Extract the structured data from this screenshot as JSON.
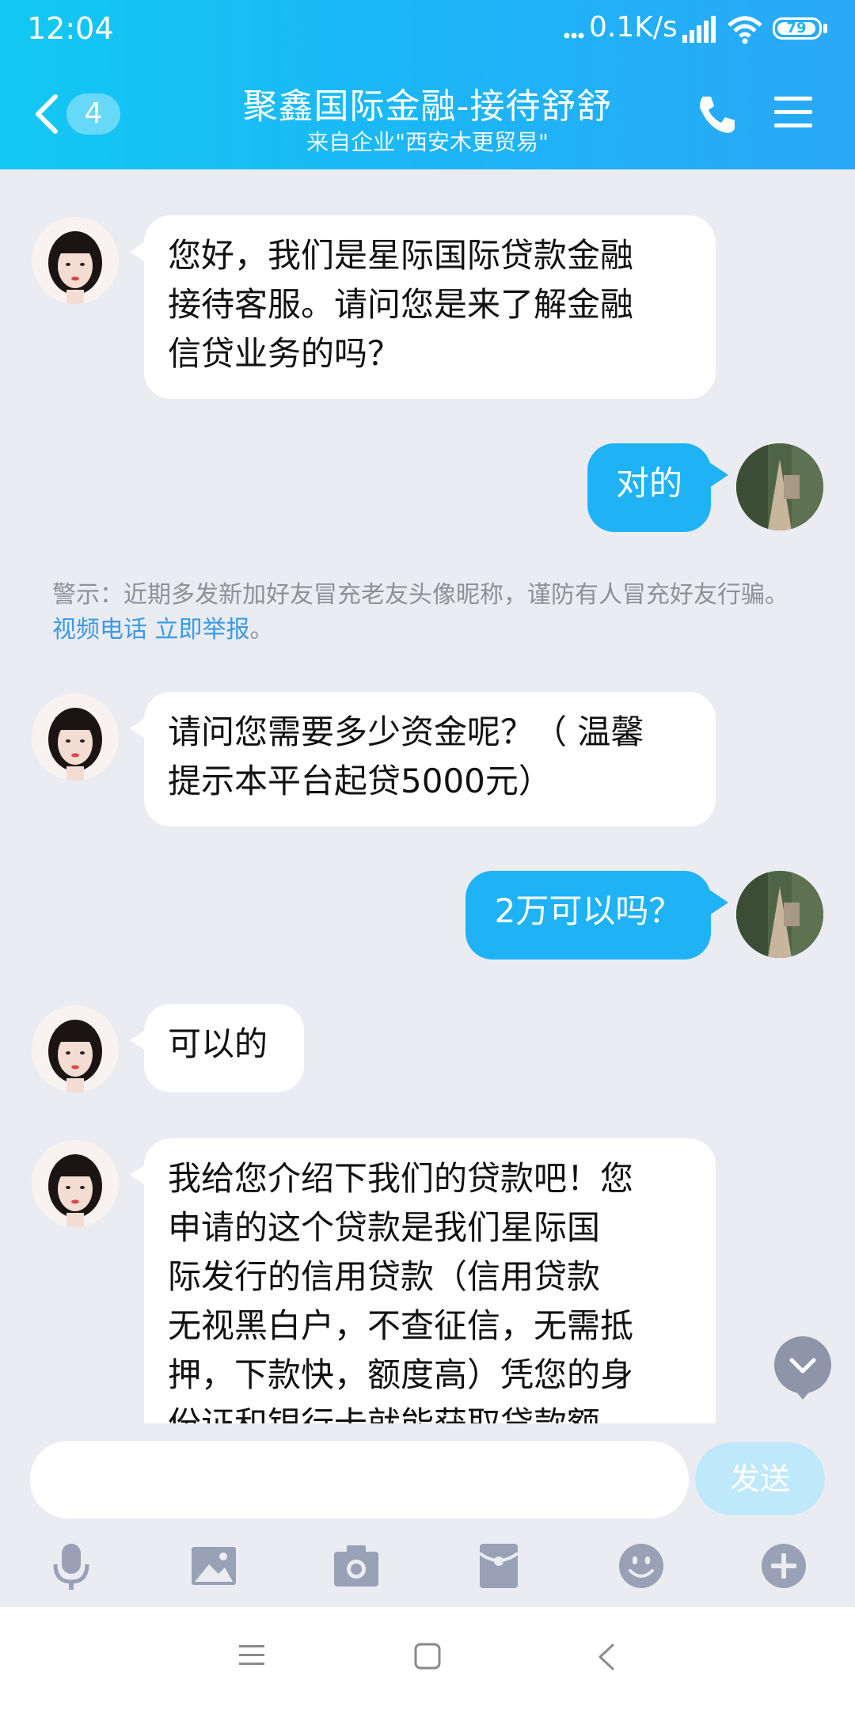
{
  "status_bar": {
    "time": "12:04",
    "network_speed": "0.1K/s",
    "battery": "79"
  },
  "header": {
    "unread_count": "4",
    "title": "聚鑫国际金融-接待舒舒",
    "subtitle": "来自企业\"西安木更贸易\""
  },
  "messages": [
    {
      "from": "contact",
      "text": "您好，我们是星际国际贷款金融接待客服。请问您是来了解金融信贷业务的吗？",
      "lines": [
        "您好，我们是星际国际贷款金融",
        "接待客服。请问您是来了解金融",
        "信贷业务的吗？"
      ]
    },
    {
      "from": "me",
      "text": "对的"
    },
    {
      "from": "contact",
      "text": "请问您需要多少资金呢？（ 温馨提示本平台起贷5000元）",
      "lines": [
        "请问您需要多少资金呢？（ 温馨",
        "提示本平台起贷5000元）"
      ]
    },
    {
      "from": "me",
      "text": "2万可以吗？"
    },
    {
      "from": "contact",
      "text": "可以的"
    },
    {
      "from": "contact",
      "text": "我给您介绍下我们的贷款吧！您申请的这个贷款是我们星际国际发行的信用贷款（信用贷款无视黑白户，不查征信，无需抵押，下款快，额度高）凭您的身份证和银行卡就能获取贷款额",
      "lines": [
        "我给您介绍下我们的贷款吧！您",
        "申请的这个贷款是我们星际国",
        "际发行的信用贷款（信用贷款",
        "无视黑白户，不查征信，无需抵",
        "押，下款快，额度高）凭您的身",
        "份证和银行卡就能获取贷款额"
      ]
    }
  ],
  "warning": {
    "text": "警示：近期多发新加好友冒充老友头像昵称，谨防有人冒充好友行骗。",
    "link_video": "视频电话",
    "link_report": "立即举报",
    "end": "。"
  },
  "input": {
    "placeholder": "",
    "send_label": "发送"
  },
  "toolbar_icons": [
    "microphone-icon",
    "image-icon",
    "camera-icon",
    "red-packet-icon",
    "emoji-icon",
    "plus-icon"
  ],
  "colors": {
    "header_start": "#12c8f4",
    "header_end": "#2aa8f8",
    "outgoing_bubble": "#1fb3f6",
    "background": "#eaecf2",
    "link": "#3b9ae6"
  }
}
